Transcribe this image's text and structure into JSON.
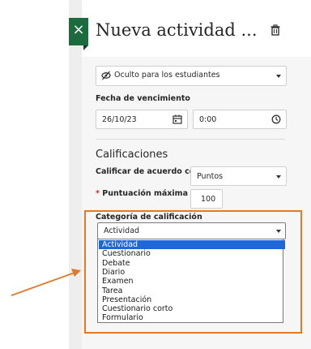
{
  "header": {
    "title": "Nueva actividad ...",
    "close_label": "×"
  },
  "visibility": {
    "selected": "Oculto para los estudiantes"
  },
  "due": {
    "label": "Fecha de vencimiento",
    "date_value": "26/10/23",
    "time_value": "0:00"
  },
  "grading": {
    "section_title": "Calificaciones",
    "grade_by_label": "Calificar de acuerdo con",
    "grade_by_value": "Puntos",
    "required_mark": "*",
    "max_score_label": "Puntuación máxima",
    "max_score_value": "100",
    "category_label": "Categoría de calificación",
    "category_selected": "Actividad",
    "category_options": [
      "Actividad",
      "Cuestionario",
      "Debate",
      "Diario",
      "Examen",
      "Tarea",
      "Presentación",
      "Cuestionario corto",
      "Formulario"
    ]
  },
  "colors": {
    "accent_green": "#1c6b3f",
    "highlight_orange": "#e07a2b",
    "selection_blue": "#1f66d8"
  }
}
